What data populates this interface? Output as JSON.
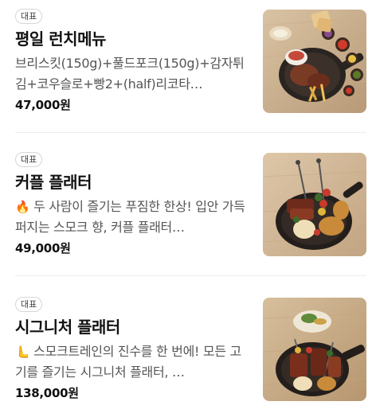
{
  "menu": {
    "items": [
      {
        "badge": "대표",
        "name": "평일 런치메뉴",
        "desc": "브리스킷(150g)+풀드포크(150g)+감자튀김+코우슬로+빵2+(half)리코타…",
        "emoji": "",
        "price": "47,000원"
      },
      {
        "badge": "대표",
        "name": "커플 플래터",
        "emoji": "🔥",
        "desc": " 두 사람이 즐기는 푸짐한 한상! 입안 가득 퍼지는 스모크 향, 커플 플래터…",
        "price": "49,000원"
      },
      {
        "badge": "대표",
        "name": "시그니처 플래터",
        "emoji": "🫷",
        "desc": " 스모크트레인의 진수를 한 번에! 모든 고기를 즐기는 시그니처 플래터, …",
        "price": "138,000원"
      }
    ]
  }
}
